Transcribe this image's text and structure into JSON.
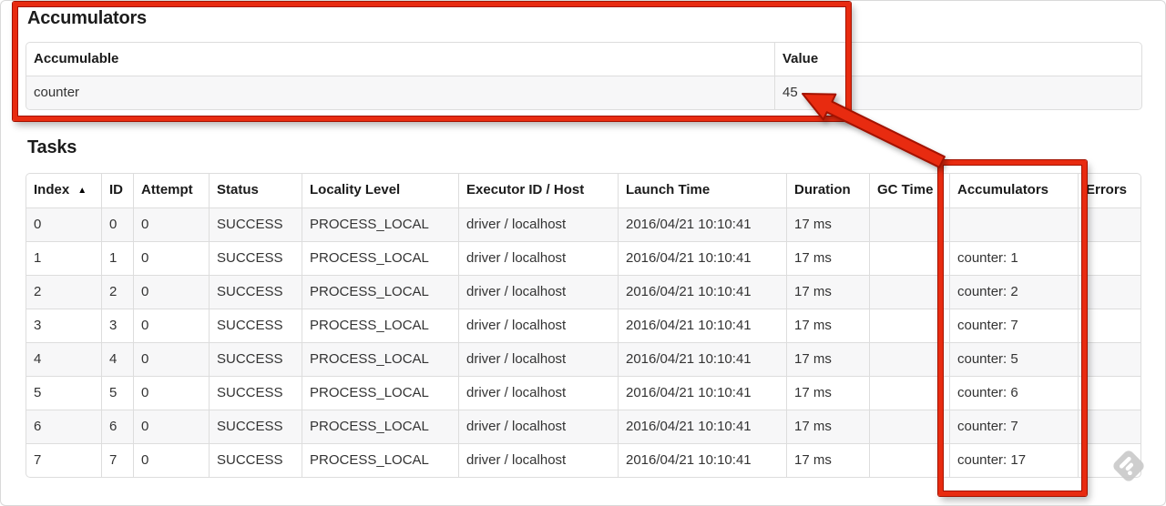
{
  "accumulators_section": {
    "title": "Accumulators",
    "table": {
      "headers": [
        "Accumulable",
        "Value"
      ],
      "rows": [
        [
          "counter",
          "45"
        ]
      ]
    }
  },
  "tasks_section": {
    "title": "Tasks",
    "table": {
      "headers": [
        "Index",
        "ID",
        "Attempt",
        "Status",
        "Locality Level",
        "Executor ID / Host",
        "Launch Time",
        "Duration",
        "GC Time",
        "Accumulators",
        "Errors"
      ],
      "sort_column": 0,
      "sort_icon": "▲",
      "rows": [
        [
          "0",
          "0",
          "0",
          "SUCCESS",
          "PROCESS_LOCAL",
          "driver / localhost",
          "2016/04/21 10:10:41",
          "17 ms",
          "",
          "",
          ""
        ],
        [
          "1",
          "1",
          "0",
          "SUCCESS",
          "PROCESS_LOCAL",
          "driver / localhost",
          "2016/04/21 10:10:41",
          "17 ms",
          "",
          "counter: 1",
          ""
        ],
        [
          "2",
          "2",
          "0",
          "SUCCESS",
          "PROCESS_LOCAL",
          "driver / localhost",
          "2016/04/21 10:10:41",
          "17 ms",
          "",
          "counter: 2",
          ""
        ],
        [
          "3",
          "3",
          "0",
          "SUCCESS",
          "PROCESS_LOCAL",
          "driver / localhost",
          "2016/04/21 10:10:41",
          "17 ms",
          "",
          "counter: 7",
          ""
        ],
        [
          "4",
          "4",
          "0",
          "SUCCESS",
          "PROCESS_LOCAL",
          "driver / localhost",
          "2016/04/21 10:10:41",
          "17 ms",
          "",
          "counter: 5",
          ""
        ],
        [
          "5",
          "5",
          "0",
          "SUCCESS",
          "PROCESS_LOCAL",
          "driver / localhost",
          "2016/04/21 10:10:41",
          "17 ms",
          "",
          "counter: 6",
          ""
        ],
        [
          "6",
          "6",
          "0",
          "SUCCESS",
          "PROCESS_LOCAL",
          "driver / localhost",
          "2016/04/21 10:10:41",
          "17 ms",
          "",
          "counter: 7",
          ""
        ],
        [
          "7",
          "7",
          "0",
          "SUCCESS",
          "PROCESS_LOCAL",
          "driver / localhost",
          "2016/04/21 10:10:41",
          "17 ms",
          "",
          "counter: 17",
          ""
        ]
      ]
    }
  },
  "colors": {
    "annotation_red": "#e82b10",
    "annotation_red_dark": "#a31200",
    "table_border": "#dddddd",
    "row_stripe": "#f7f7f8",
    "watermark_grey": "#c9c9c9"
  }
}
